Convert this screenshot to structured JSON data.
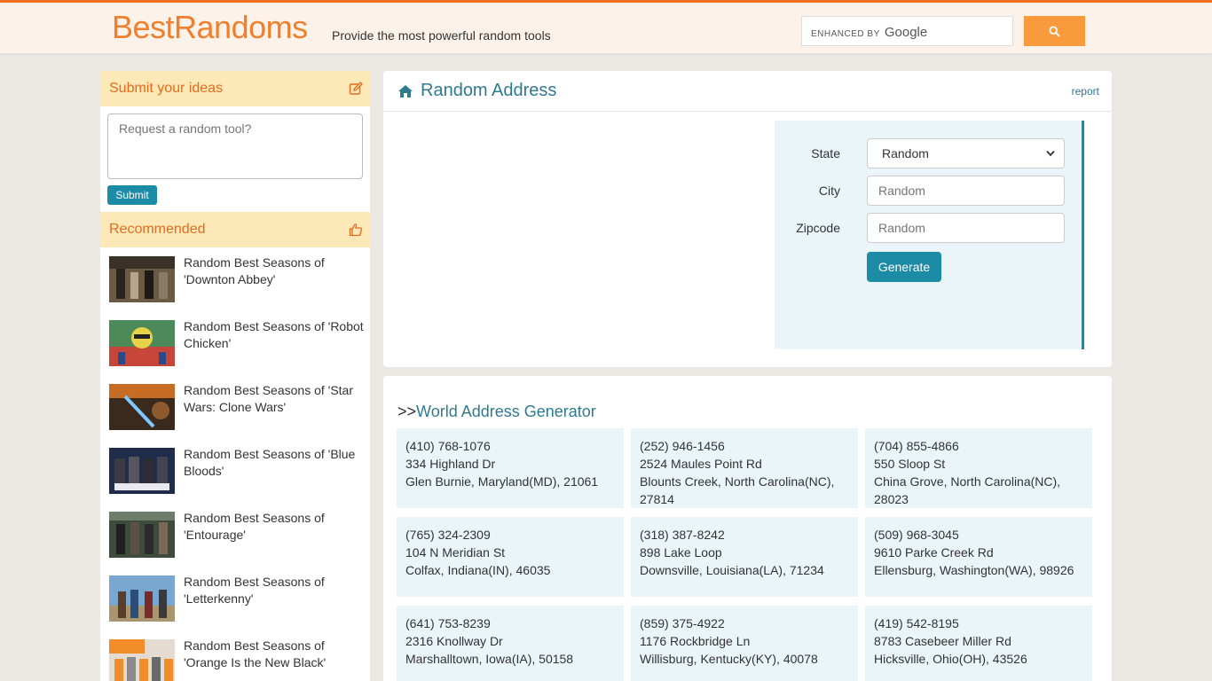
{
  "header": {
    "logo": "BestRandoms",
    "tagline": "Provide the most powerful random tools",
    "search_brand_prefix": "ENHANCED BY",
    "search_brand_name": "Google"
  },
  "sidebar": {
    "ideas_title": "Submit your ideas",
    "ideas_placeholder": "Request a random tool?",
    "submit_label": "Submit",
    "recommended_title": "Recommended",
    "items": [
      {
        "label": "Random Best Seasons of 'Downton Abbey'"
      },
      {
        "label": "Random Best Seasons of 'Robot Chicken'"
      },
      {
        "label": "Random Best Seasons of 'Star Wars: Clone Wars'"
      },
      {
        "label": "Random Best Seasons of 'Blue Bloods'"
      },
      {
        "label": "Random Best Seasons of 'Entourage'"
      },
      {
        "label": "Random Best Seasons of 'Letterkenny'"
      },
      {
        "label": "Random Best Seasons of 'Orange Is the New Black'"
      }
    ]
  },
  "main": {
    "title": "Random Address",
    "report_label": "report",
    "form": {
      "state_label": "State",
      "state_value": "Random",
      "city_label": "City",
      "city_placeholder": "Random",
      "zip_label": "Zipcode",
      "zip_placeholder": "Random",
      "generate_label": "Generate"
    }
  },
  "world": {
    "prefix": ">>",
    "title": "World Address Generator",
    "addresses": [
      {
        "phone": "(410) 768-1076",
        "street": "334 Highland Dr",
        "city": "Glen Burnie, Maryland(MD), 21061"
      },
      {
        "phone": "(252) 946-1456",
        "street": "2524 Maules Point Rd",
        "city": "Blounts Creek, North Carolina(NC), 27814"
      },
      {
        "phone": "(704) 855-4866",
        "street": "550 Sloop St",
        "city": "China Grove, North Carolina(NC), 28023"
      },
      {
        "phone": "(765) 324-2309",
        "street": "104 N Meridian St",
        "city": "Colfax, Indiana(IN), 46035"
      },
      {
        "phone": "(318) 387-8242",
        "street": "898 Lake Loop",
        "city": "Downsville, Louisiana(LA), 71234"
      },
      {
        "phone": "(509) 968-3045",
        "street": "9610 Parke Creek Rd",
        "city": "Ellensburg, Washington(WA), 98926"
      },
      {
        "phone": "(641) 753-8239",
        "street": "2316 Knollway Dr",
        "city": "Marshalltown, Iowa(IA), 50158"
      },
      {
        "phone": "(859) 375-4922",
        "street": "1176 Rockbridge Ln",
        "city": "Willisburg, Kentucky(KY), 40078"
      },
      {
        "phone": "(419) 542-8195",
        "street": "8783 Casebeer Miller Rd",
        "city": "Hicksville, Ohio(OH), 43526"
      }
    ]
  },
  "colors": {
    "accent": "#f26f21",
    "teal": "#1b8ba6",
    "panel": "#e9f5f9"
  }
}
